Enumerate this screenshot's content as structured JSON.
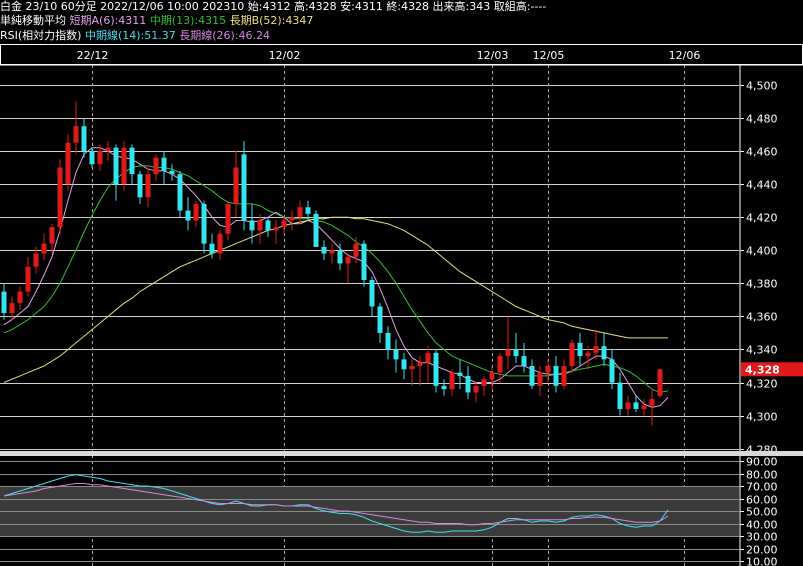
{
  "header": {
    "line1": "白金 23/10 60分足 2022/12/06 10:00 202310 始:4312 高:4328 安:4311 終:4328 出来高:343 取組高:----",
    "ma_title": "単純移動平均",
    "ma_short": "短期A(6):4311",
    "ma_mid": "中期(13):4315",
    "ma_long": "長期B(52):4347",
    "rsi_title": "RSI(相対力指数)",
    "rsi_mid": "中期線(14):51.37",
    "rsi_long": "長期線(26):46.24"
  },
  "colors": {
    "background": "#000000",
    "up": "#e01a1a",
    "down": "#33e5ee",
    "ma_short": "#e4a0e6",
    "ma_mid": "#2fc22f",
    "ma_long": "#e6e07a",
    "rsi_mid": "#3ee0ee",
    "rsi_long": "#d08ad8",
    "price_tag": "#e01a1a"
  },
  "chart_data": [
    {
      "type": "candlestick",
      "date_labels": [
        "22/12",
        "12/02",
        "12/03",
        "12/05",
        "12/06"
      ],
      "date_label_index": [
        11,
        35,
        61,
        68,
        85
      ],
      "y_ticks": [
        "4,500",
        "4,480",
        "4,460",
        "4,440",
        "4,420",
        "4,400",
        "4,380",
        "4,360",
        "4,340",
        "4,320",
        "4,300",
        "4,280"
      ],
      "y_tick_values": [
        4500,
        4480,
        4460,
        4440,
        4420,
        4400,
        4380,
        4360,
        4340,
        4320,
        4300,
        4280
      ],
      "ylim": [
        4278,
        4512
      ],
      "last_price_label": "4,328",
      "last_price": 4328,
      "ohlc": [
        [
          4375,
          4380,
          4358,
          4362
        ],
        [
          4362,
          4372,
          4358,
          4368
        ],
        [
          4368,
          4378,
          4364,
          4375
        ],
        [
          4375,
          4396,
          4372,
          4390
        ],
        [
          4390,
          4402,
          4386,
          4398
        ],
        [
          4398,
          4410,
          4394,
          4404
        ],
        [
          4404,
          4416,
          4398,
          4414
        ],
        [
          4414,
          4455,
          4410,
          4450
        ],
        [
          4440,
          4470,
          4436,
          4465
        ],
        [
          4465,
          4490,
          4458,
          4475
        ],
        [
          4475,
          4480,
          4456,
          4460
        ],
        [
          4460,
          4462,
          4450,
          4452
        ],
        [
          4452,
          4464,
          4448,
          4460
        ],
        [
          4460,
          4466,
          4454,
          4462
        ],
        [
          4462,
          4464,
          4430,
          4440
        ],
        [
          4440,
          4466,
          4436,
          4462
        ],
        [
          4462,
          4464,
          4440,
          4446
        ],
        [
          4446,
          4448,
          4428,
          4432
        ],
        [
          4432,
          4450,
          4426,
          4446
        ],
        [
          4446,
          4458,
          4442,
          4456
        ],
        [
          4456,
          4460,
          4440,
          4448
        ],
        [
          4448,
          4452,
          4442,
          4446
        ],
        [
          4446,
          4448,
          4420,
          4424
        ],
        [
          4424,
          4432,
          4412,
          4418
        ],
        [
          4418,
          4430,
          4414,
          4428
        ],
        [
          4428,
          4430,
          4398,
          4404
        ],
        [
          4404,
          4410,
          4395,
          4398
        ],
        [
          4398,
          4412,
          4394,
          4410
        ],
        [
          4410,
          4430,
          4406,
          4428
        ],
        [
          4428,
          4460,
          4420,
          4450
        ],
        [
          4458,
          4466,
          4412,
          4418
        ],
        [
          4418,
          4428,
          4404,
          4412
        ],
        [
          4412,
          4422,
          4404,
          4418
        ],
        [
          4418,
          4420,
          4408,
          4412
        ],
        [
          4412,
          4418,
          4404,
          4414
        ],
        [
          4414,
          4420,
          4410,
          4418
        ],
        [
          4418,
          4424,
          4412,
          4420
        ],
        [
          4420,
          4430,
          4416,
          4426
        ],
        [
          4426,
          4430,
          4418,
          4422
        ],
        [
          4422,
          4424,
          4402,
          4402
        ],
        [
          4402,
          4406,
          4394,
          4398
        ],
        [
          4398,
          4404,
          4392,
          4400
        ],
        [
          4400,
          4404,
          4388,
          4392
        ],
        [
          4392,
          4398,
          4380,
          4396
        ],
        [
          4396,
          4408,
          4392,
          4404
        ],
        [
          4404,
          4406,
          4378,
          4382
        ],
        [
          4382,
          4384,
          4360,
          4366
        ],
        [
          4366,
          4368,
          4344,
          4350
        ],
        [
          4350,
          4354,
          4334,
          4340
        ],
        [
          4340,
          4346,
          4326,
          4334
        ],
        [
          4334,
          4338,
          4322,
          4328
        ],
        [
          4328,
          4334,
          4318,
          4330
        ],
        [
          4330,
          4336,
          4318,
          4332
        ],
        [
          4332,
          4342,
          4320,
          4338
        ],
        [
          4338,
          4340,
          4314,
          4318
        ],
        [
          4318,
          4322,
          4312,
          4316
        ],
        [
          4316,
          4328,
          4312,
          4326
        ],
        [
          4326,
          4334,
          4316,
          4324
        ],
        [
          4324,
          4330,
          4310,
          4314
        ],
        [
          4314,
          4320,
          4308,
          4318
        ],
        [
          4318,
          4324,
          4312,
          4322
        ],
        [
          4322,
          4330,
          4316,
          4326
        ],
        [
          4326,
          4338,
          4320,
          4336
        ],
        [
          4336,
          4360,
          4328,
          4340
        ],
        [
          4340,
          4350,
          4332,
          4336
        ],
        [
          4336,
          4344,
          4326,
          4330
        ],
        [
          4330,
          4334,
          4316,
          4318
        ],
        [
          4318,
          4330,
          4312,
          4326
        ],
        [
          4326,
          4334,
          4320,
          4330
        ],
        [
          4330,
          4336,
          4314,
          4318
        ],
        [
          4318,
          4334,
          4316,
          4330
        ],
        [
          4330,
          4346,
          4326,
          4344
        ],
        [
          4344,
          4350,
          4330,
          4336
        ],
        [
          4336,
          4342,
          4328,
          4338
        ],
        [
          4338,
          4352,
          4334,
          4342
        ],
        [
          4342,
          4350,
          4330,
          4334
        ],
        [
          4334,
          4340,
          4316,
          4320
        ],
        [
          4320,
          4326,
          4300,
          4304
        ],
        [
          4304,
          4312,
          4300,
          4308
        ],
        [
          4308,
          4312,
          4302,
          4304
        ],
        [
          4304,
          4310,
          4300,
          4306
        ],
        [
          4306,
          4316,
          4294,
          4310
        ],
        [
          4312,
          4328,
          4311,
          4328
        ]
      ],
      "series": [
        {
          "name": "短期A(6)",
          "values": [
            4355,
            4358,
            4362,
            4366,
            4375,
            4385,
            4396,
            4412,
            4430,
            4447,
            4458,
            4462,
            4462,
            4460,
            4457,
            4456,
            4455,
            4452,
            4449,
            4448,
            4448,
            4446,
            4443,
            4438,
            4433,
            4427,
            4420,
            4415,
            4414,
            4418,
            4418,
            4417,
            4418,
            4420,
            4423,
            4420,
            4416,
            4416,
            4418,
            4416,
            4411,
            4406,
            4401,
            4397,
            4395,
            4393,
            4387,
            4377,
            4365,
            4352,
            4342,
            4335,
            4332,
            4332,
            4330,
            4328,
            4326,
            4325,
            4322,
            4320,
            4320,
            4320,
            4322,
            4326,
            4330,
            4330,
            4328,
            4326,
            4325,
            4325,
            4325,
            4327,
            4330,
            4333,
            4336,
            4336,
            4334,
            4328,
            4320,
            4312,
            4307,
            4305,
            4306,
            4311
          ]
        },
        {
          "name": "中期(13)",
          "values": [
            4350,
            4352,
            4355,
            4358,
            4362,
            4366,
            4372,
            4380,
            4390,
            4400,
            4411,
            4421,
            4430,
            4438,
            4443,
            4447,
            4450,
            4451,
            4451,
            4450,
            4450,
            4449,
            4447,
            4445,
            4442,
            4439,
            4436,
            4432,
            4429,
            4428,
            4428,
            4428,
            4427,
            4424,
            4422,
            4420,
            4419,
            4419,
            4419,
            4418,
            4417,
            4415,
            4412,
            4409,
            4405,
            4402,
            4398,
            4393,
            4387,
            4380,
            4372,
            4364,
            4357,
            4350,
            4344,
            4340,
            4336,
            4334,
            4332,
            4330,
            4328,
            4326,
            4325,
            4324,
            4324,
            4324,
            4324,
            4324,
            4324,
            4325,
            4326,
            4327,
            4328,
            4329,
            4330,
            4331,
            4330,
            4329,
            4327,
            4324,
            4320,
            4316,
            4314,
            4315
          ]
        },
        {
          "name": "長期B(52)",
          "values": [
            4320,
            4322,
            4324,
            4326,
            4328,
            4330,
            4333,
            4336,
            4340,
            4344,
            4348,
            4352,
            4356,
            4360,
            4364,
            4368,
            4371,
            4375,
            4378,
            4381,
            4384,
            4387,
            4390,
            4392,
            4394,
            4396,
            4398,
            4400,
            4402,
            4404,
            4406,
            4408,
            4410,
            4412,
            4413,
            4415,
            4416,
            4417,
            4418,
            4419,
            4419,
            4420,
            4420,
            4420,
            4419,
            4419,
            4418,
            4417,
            4416,
            4414,
            4412,
            4409,
            4406,
            4403,
            4399,
            4395,
            4391,
            4387,
            4384,
            4381,
            4378,
            4375,
            4372,
            4369,
            4366,
            4364,
            4362,
            4360,
            4358,
            4357,
            4356,
            4354,
            4353,
            4352,
            4351,
            4350,
            4349,
            4348,
            4347,
            4347,
            4347,
            4347,
            4347,
            4347
          ]
        }
      ]
    },
    {
      "type": "line",
      "title": "RSI(相対力指数)",
      "y_ticks": [
        "90.00",
        "80.00",
        "70.00",
        "60.00",
        "50.00",
        "40.00",
        "30.00",
        "20.00",
        "10.00"
      ],
      "y_tick_values": [
        90,
        80,
        70,
        60,
        50,
        40,
        30,
        20,
        10
      ],
      "ylim": [
        6,
        94
      ],
      "band": [
        30,
        70
      ],
      "series": [
        {
          "name": "中期線(14)",
          "values": [
            62,
            64,
            66,
            68,
            70,
            72,
            74,
            76,
            78,
            79,
            78,
            77,
            76,
            74,
            73,
            72,
            71,
            70,
            70,
            69,
            68,
            66,
            64,
            62,
            60,
            58,
            56,
            55,
            56,
            58,
            56,
            54,
            54,
            55,
            55,
            54,
            54,
            55,
            55,
            52,
            50,
            49,
            48,
            48,
            47,
            45,
            42,
            40,
            38,
            36,
            34,
            33,
            33,
            34,
            33,
            33,
            34,
            34,
            34,
            34,
            35,
            37,
            41,
            44,
            44,
            43,
            41,
            42,
            42,
            41,
            42,
            45,
            46,
            46,
            47,
            46,
            44,
            40,
            38,
            37,
            38,
            38,
            42,
            51
          ]
        },
        {
          "name": "長期線(26)",
          "values": [
            62,
            63,
            64,
            65,
            66,
            68,
            69,
            70,
            71,
            72,
            72,
            71,
            71,
            70,
            69,
            68,
            67,
            66,
            65,
            64,
            63,
            62,
            61,
            60,
            59,
            58,
            57,
            56,
            56,
            56,
            56,
            55,
            55,
            55,
            55,
            54,
            54,
            54,
            54,
            53,
            52,
            51,
            50,
            50,
            49,
            48,
            47,
            46,
            45,
            44,
            43,
            42,
            41,
            41,
            40,
            40,
            40,
            40,
            39,
            39,
            40,
            40,
            41,
            42,
            43,
            43,
            43,
            43,
            43,
            43,
            43,
            44,
            44,
            45,
            45,
            45,
            44,
            43,
            42,
            41,
            41,
            41,
            42,
            46
          ]
        }
      ]
    }
  ]
}
